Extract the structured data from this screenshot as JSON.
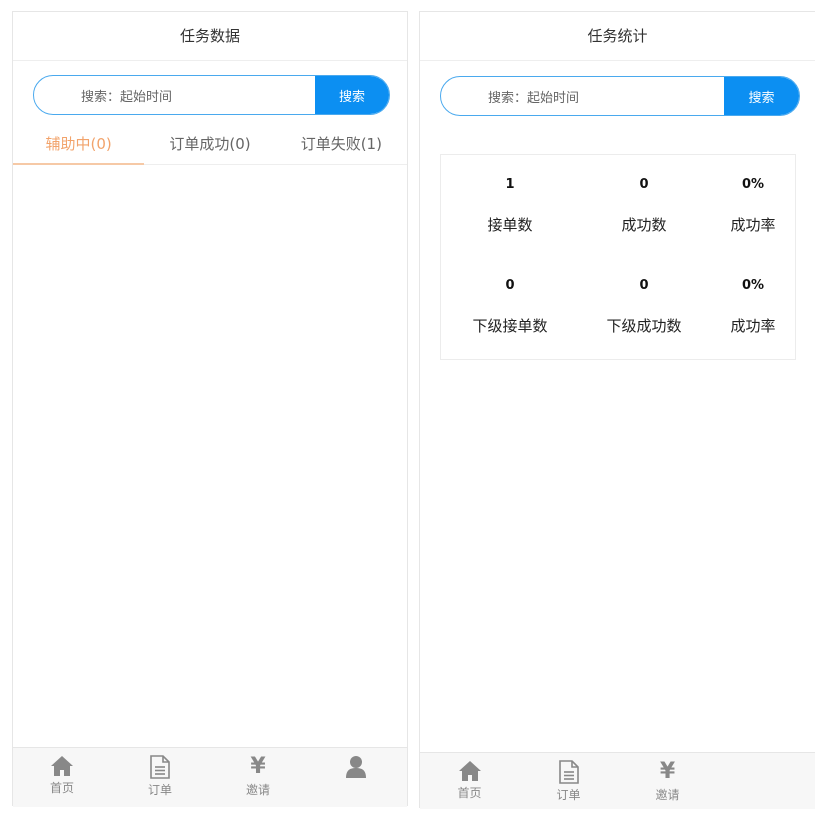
{
  "left": {
    "title": "任务数据",
    "search": {
      "placeholder": "搜索：起始时间",
      "button": "搜索"
    },
    "tabs": [
      {
        "label": "辅助中(0)",
        "active": true
      },
      {
        "label": "订单成功(0)",
        "active": false
      },
      {
        "label": "订单失败(1)",
        "active": false
      }
    ],
    "tabbar": [
      {
        "icon": "home-icon",
        "label": "首页"
      },
      {
        "icon": "document-icon",
        "label": "订单"
      },
      {
        "icon": "yen-icon",
        "label": "邀请"
      },
      {
        "icon": "user-icon",
        "label": ""
      }
    ]
  },
  "right": {
    "title": "任务统计",
    "search": {
      "placeholder": "搜索：起始时间",
      "button": "搜索"
    },
    "stats": {
      "orders": {
        "value": "1",
        "label": "接单数"
      },
      "success": {
        "value": "0",
        "label": "成功数"
      },
      "rate": {
        "value": "0%",
        "label": "成功率"
      },
      "sub_orders": {
        "value": "0",
        "label": "下级接单数"
      },
      "sub_success": {
        "value": "0",
        "label": "下级成功数"
      },
      "sub_rate": {
        "value": "0%",
        "label": "成功率"
      }
    },
    "tabbar": [
      {
        "icon": "home-icon",
        "label": "首页"
      },
      {
        "icon": "document-icon",
        "label": "订单"
      },
      {
        "icon": "yen-icon",
        "label": "邀请"
      }
    ]
  },
  "colors": {
    "accent": "#0c8ff2",
    "active_tab": "#f2a36b",
    "search_border": "#4aa9ee",
    "tabbar_text": "#888888"
  },
  "yen_glyph": "¥"
}
